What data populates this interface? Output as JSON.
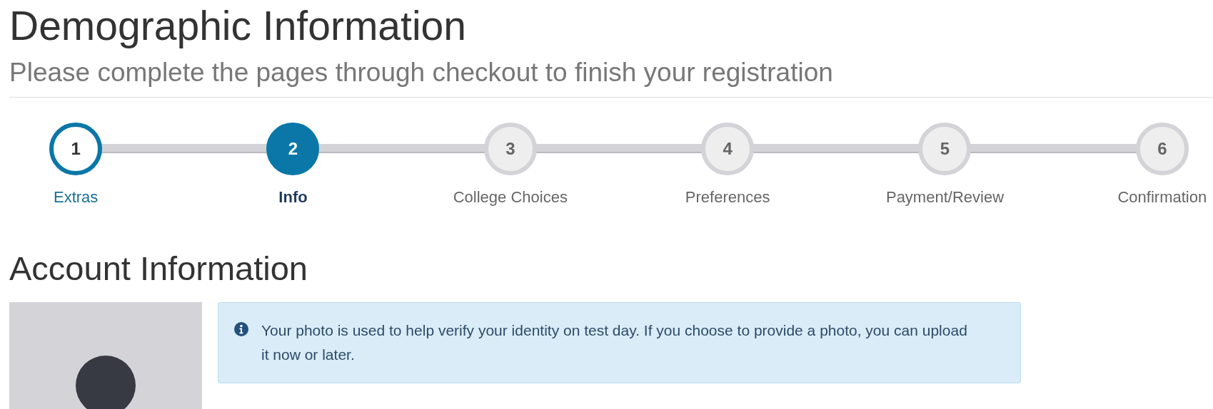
{
  "header": {
    "title": "Demographic Information",
    "subtitle": "Please complete the pages through checkout to finish your registration"
  },
  "steps": [
    {
      "number": "1",
      "label": "Extras",
      "completed": true,
      "selected": false
    },
    {
      "number": "2",
      "label": "Info",
      "completed": false,
      "selected": true
    },
    {
      "number": "3",
      "label": "College Choices",
      "completed": false,
      "selected": false
    },
    {
      "number": "4",
      "label": "Preferences",
      "completed": false,
      "selected": false
    },
    {
      "number": "5",
      "label": "Payment/Review",
      "completed": false,
      "selected": false
    },
    {
      "number": "6",
      "label": "Confirmation",
      "completed": false,
      "selected": false
    }
  ],
  "section": {
    "title": "Account Information"
  },
  "info_alert": {
    "text": "Your photo is used to help verify your identity on test day. If you choose to provide a photo, you can upload it now or later."
  }
}
